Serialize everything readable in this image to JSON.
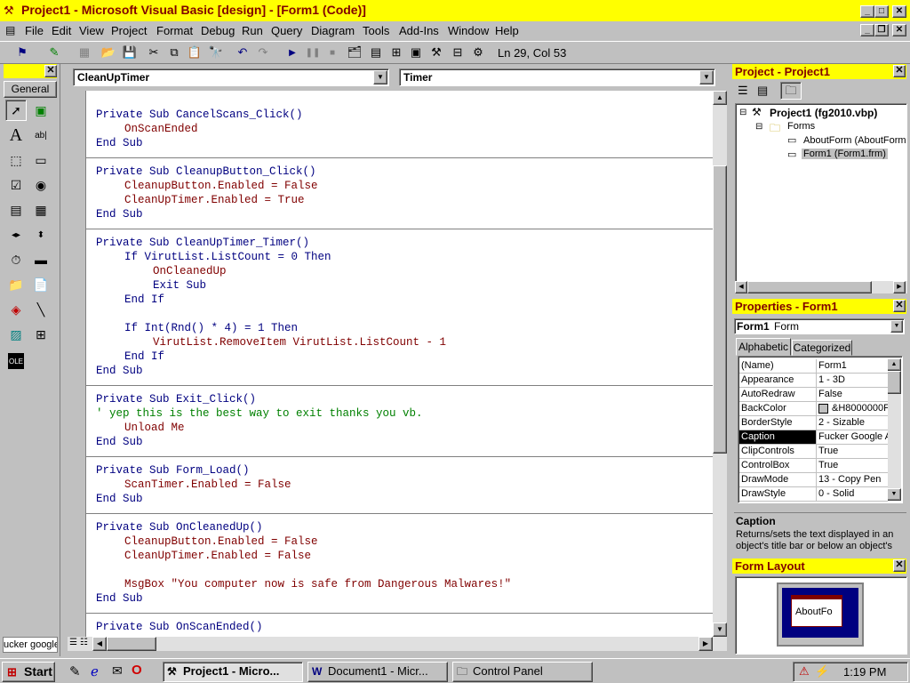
{
  "window": {
    "title": "Project1 - Microsoft Visual Basic [design] - [Form1 (Code)]"
  },
  "menu": [
    "File",
    "Edit",
    "View",
    "Project",
    "Format",
    "Debug",
    "Run",
    "Query",
    "Diagram",
    "Tools",
    "Add-Ins",
    "Window",
    "Help"
  ],
  "toolbar": {
    "position": "Ln 29, Col 53"
  },
  "toolbox": {
    "tab_label": "General",
    "bottom_text": "ucker google"
  },
  "code": {
    "object_dropdown": "CleanUpTimer",
    "proc_dropdown": "Timer",
    "lines": [
      {
        "indent": 0,
        "text": "Private Sub CancelScans_Click()"
      },
      {
        "indent": 1,
        "text": "OnScanEnded"
      },
      {
        "indent": 0,
        "text": "End Sub"
      },
      {
        "indent": 0,
        "text": "Private Sub CleanupButton_Click()"
      },
      {
        "indent": 1,
        "text": "CleanupButton.Enabled = False"
      },
      {
        "indent": 1,
        "text": "CleanUpTimer.Enabled = True"
      },
      {
        "indent": 0,
        "text": "End Sub"
      },
      {
        "indent": 0,
        "text": "Private Sub CleanUpTimer_Timer()"
      },
      {
        "indent": 1,
        "text": "If VirutList.ListCount = 0 Then"
      },
      {
        "indent": 2,
        "text": "OnCleanedUp"
      },
      {
        "indent": 2,
        "text": "Exit Sub"
      },
      {
        "indent": 1,
        "text": "End If"
      },
      {
        "indent": 1,
        "text": "If Int(Rnd() * 4) = 1 Then"
      },
      {
        "indent": 2,
        "text": "VirutList.RemoveItem VirutList.ListCount - 1"
      },
      {
        "indent": 1,
        "text": "End If"
      },
      {
        "indent": 0,
        "text": "End Sub"
      },
      {
        "indent": 0,
        "text": "Private Sub Exit_Click()"
      },
      {
        "indent": 0,
        "text": "' yep this is the best way to exit thanks you vb."
      },
      {
        "indent": 1,
        "text": "Unload Me"
      },
      {
        "indent": 0,
        "text": "End Sub"
      },
      {
        "indent": 0,
        "text": "Private Sub Form_Load()"
      },
      {
        "indent": 1,
        "text": "ScanTimer.Enabled = False"
      },
      {
        "indent": 0,
        "text": "End Sub"
      },
      {
        "indent": 0,
        "text": "Private Sub OnCleanedUp()"
      },
      {
        "indent": 1,
        "text": "CleanupButton.Enabled = False"
      },
      {
        "indent": 1,
        "text": "CleanUpTimer.Enabled = False"
      },
      {
        "indent": 1,
        "text": "MsgBox \"You computer now is safe from Dangerous Malwares!\""
      },
      {
        "indent": 0,
        "text": "End Sub"
      },
      {
        "indent": 0,
        "text": "Private Sub OnScanEnded()"
      }
    ]
  },
  "project": {
    "title": "Project - Project1",
    "root": "Project1 (fg2010.vbp)",
    "folder": "Forms",
    "items": [
      "AboutForm (AboutForm",
      "Form1 (Form1.frm)"
    ]
  },
  "properties": {
    "title": "Properties - Form1",
    "object": "Form1",
    "object_type": "Form",
    "tabs": [
      "Alphabetic",
      "Categorized"
    ],
    "rows": [
      {
        "name": "(Name)",
        "value": "Form1"
      },
      {
        "name": "Appearance",
        "value": "1 - 3D"
      },
      {
        "name": "AutoRedraw",
        "value": "False"
      },
      {
        "name": "BackColor",
        "value": "&H8000000F"
      },
      {
        "name": "BorderStyle",
        "value": "2 - Sizable"
      },
      {
        "name": "Caption",
        "value": "Fucker Google A"
      },
      {
        "name": "ClipControls",
        "value": "True"
      },
      {
        "name": "ControlBox",
        "value": "True"
      },
      {
        "name": "DrawMode",
        "value": "13 - Copy Pen"
      },
      {
        "name": "DrawStyle",
        "value": "0 - Solid"
      }
    ],
    "desc_title": "Caption",
    "desc_text": "Returns/sets the text displayed in an object's title bar or below an object's"
  },
  "form_layout": {
    "title": "Form Layout",
    "preview_text": "AboutFo"
  },
  "taskbar": {
    "start": "Start",
    "tasks": [
      "Project1 - Micro...",
      "Document1 - Micr...",
      "Control Panel"
    ],
    "clock": "1:19 PM"
  }
}
